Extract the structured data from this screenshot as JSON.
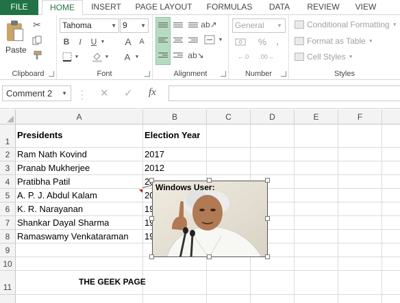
{
  "tabs": [
    "FILE",
    "HOME",
    "INSERT",
    "PAGE LAYOUT",
    "FORMULAS",
    "DATA",
    "REVIEW",
    "VIEW"
  ],
  "ribbon": {
    "clipboard": {
      "paste_label": "Paste",
      "group_label": "Clipboard"
    },
    "font": {
      "font_name": "Tahoma",
      "font_size": "9",
      "group_label": "Font",
      "bold": "B",
      "italic": "I",
      "underline": "U",
      "grow": "A",
      "shrink": "A"
    },
    "alignment": {
      "group_label": "Alignment"
    },
    "number": {
      "format": "General",
      "percent": "%",
      "comma": ",",
      "group_label": "Number"
    },
    "styles": {
      "conditional": "Conditional Formatting",
      "format_table": "Format as Table",
      "cell_styles": "Cell Styles",
      "group_label": "Styles"
    }
  },
  "formula_bar": {
    "name_box": "Comment 2",
    "cancel": "✕",
    "enter": "✓",
    "fx": "fx",
    "value": ""
  },
  "columns": [
    "A",
    "B",
    "C",
    "D",
    "E",
    "F"
  ],
  "rows": [
    "1",
    "2",
    "3",
    "4",
    "5",
    "6",
    "7",
    "8",
    "9",
    "10",
    "11"
  ],
  "cells": {
    "A1": "Presidents",
    "B1": "Election Year",
    "A2": "Ram Nath Kovind",
    "B2": "2017",
    "A3": "Pranab Mukherjee",
    "B3": "2012",
    "A4": "Pratibha Patil",
    "B4": "2007",
    "A5": "A. P. J. Abdul Kalam",
    "B5": "20",
    "A6": "K. R. Narayanan",
    "B6": "19",
    "A7": "Shankar Dayal Sharma",
    "B7": "19",
    "A8": "Ramaswamy Venkataraman",
    "B8": "19",
    "A11": "THE GEEK PAGE"
  },
  "comment": {
    "author": "Windows User:"
  },
  "colors": {
    "accent": "#217346",
    "comment_marker": "#c00000"
  }
}
